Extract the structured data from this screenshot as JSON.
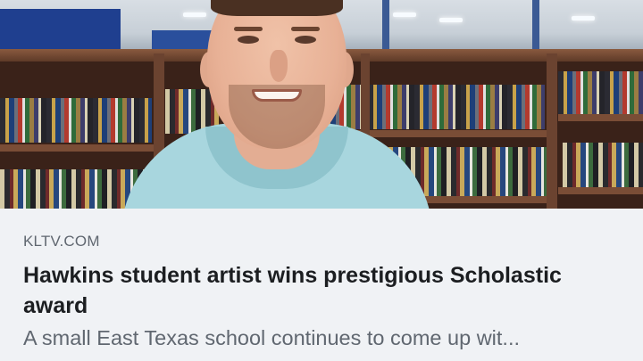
{
  "link_preview": {
    "source": "KLTV.COM",
    "headline": "Hawkins student artist wins prestigious Scholastic award",
    "description": "A small East Texas school continues to come up wit...",
    "image_subject": "student in light blue hoodie in front of library bookshelves"
  },
  "colors": {
    "background": "#f0f2f5",
    "headline_text": "#1c1e21",
    "secondary_text": "#606770",
    "hoodie": "#a8d6de"
  }
}
